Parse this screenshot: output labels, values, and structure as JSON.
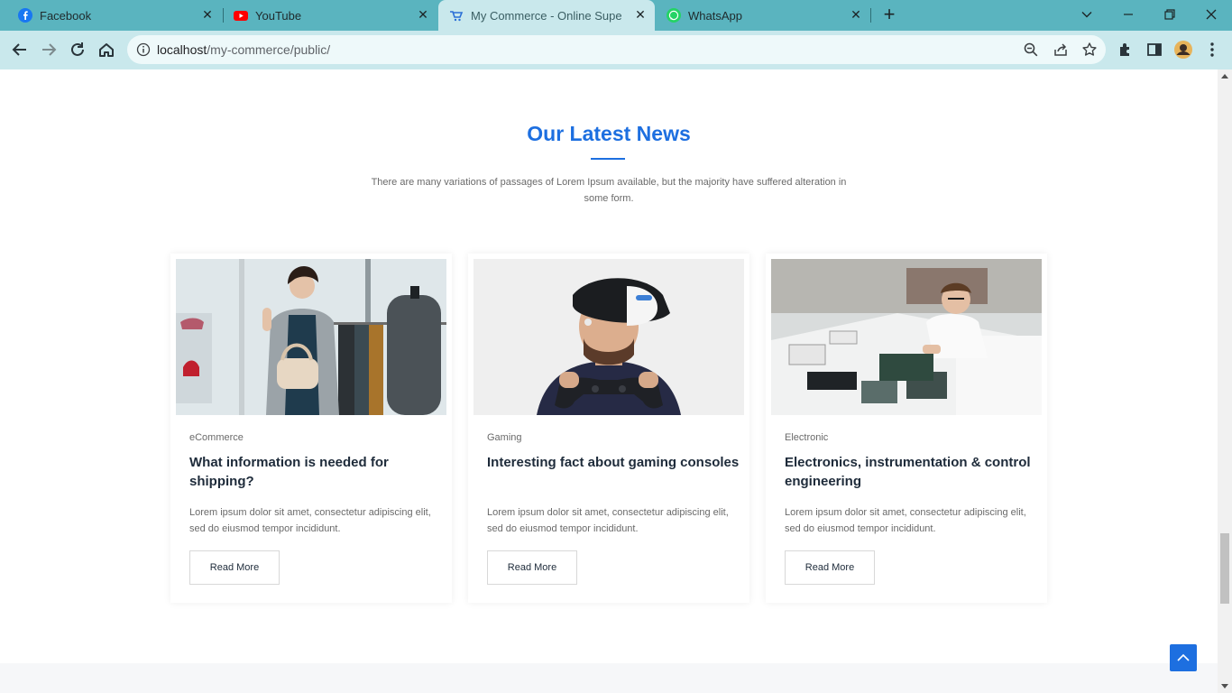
{
  "browser": {
    "tabs": [
      {
        "title": "Facebook",
        "icon": "facebook-icon",
        "active": false
      },
      {
        "title": "YouTube",
        "icon": "youtube-icon",
        "active": false
      },
      {
        "title": "My Commerce - Online Super Sh",
        "icon": "page-icon",
        "active": true
      },
      {
        "title": "WhatsApp",
        "icon": "whatsapp-icon",
        "active": false
      }
    ],
    "url_host": "localhost",
    "url_path": "/my-commerce/public/"
  },
  "news": {
    "title": "Our Latest News",
    "description": "There are many variations of passages of Lorem Ipsum available, but the majority have suffered alteration in some form.",
    "accent_color": "#1d6fe0",
    "cards": [
      {
        "category": "eCommerce",
        "headline": "What information is needed for shipping?",
        "excerpt": "Lorem ipsum dolor sit amet, consectetur adipiscing elit, sed do eiusmod tempor incididunt.",
        "button": "Read More",
        "image": "woman-shopping-photo"
      },
      {
        "category": "Gaming",
        "headline": "Interesting fact about gaming consoles",
        "excerpt": "Lorem ipsum dolor sit amet, consectetur adipiscing elit, sed do eiusmod tempor incididunt.",
        "button": "Read More",
        "image": "vr-gamer-photo"
      },
      {
        "category": "Electronic",
        "headline": "Electronics, instrumentation & control engineering",
        "excerpt": "Lorem ipsum dolor sit amet, consectetur adipiscing elit, sed do eiusmod tempor incididunt.",
        "button": "Read More",
        "image": "electronics-engineer-photo"
      }
    ]
  }
}
